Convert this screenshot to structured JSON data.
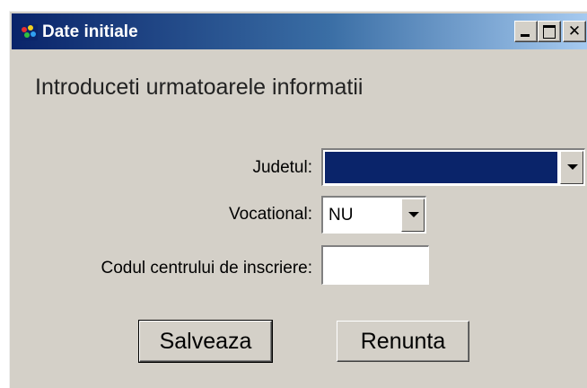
{
  "window": {
    "title": "Date initiale",
    "icon": "app-multicolor-icon",
    "controls": {
      "minimize": "minimize",
      "maximize": "maximize",
      "close": "✕"
    }
  },
  "form": {
    "heading": "Introduceti urmatoarele informatii",
    "judet": {
      "label": "Judetul:",
      "value": ""
    },
    "vocational": {
      "label": "Vocational:",
      "value": "NU"
    },
    "cod_centru": {
      "label": "Codul centrului de inscriere:",
      "value": ""
    }
  },
  "buttons": {
    "save": "Salveaza",
    "cancel": "Renunta"
  },
  "colors": {
    "titlebar_start": "#0a246a",
    "titlebar_end": "#a6caf0",
    "face": "#d4d0c8",
    "selection": "#0a246a"
  }
}
